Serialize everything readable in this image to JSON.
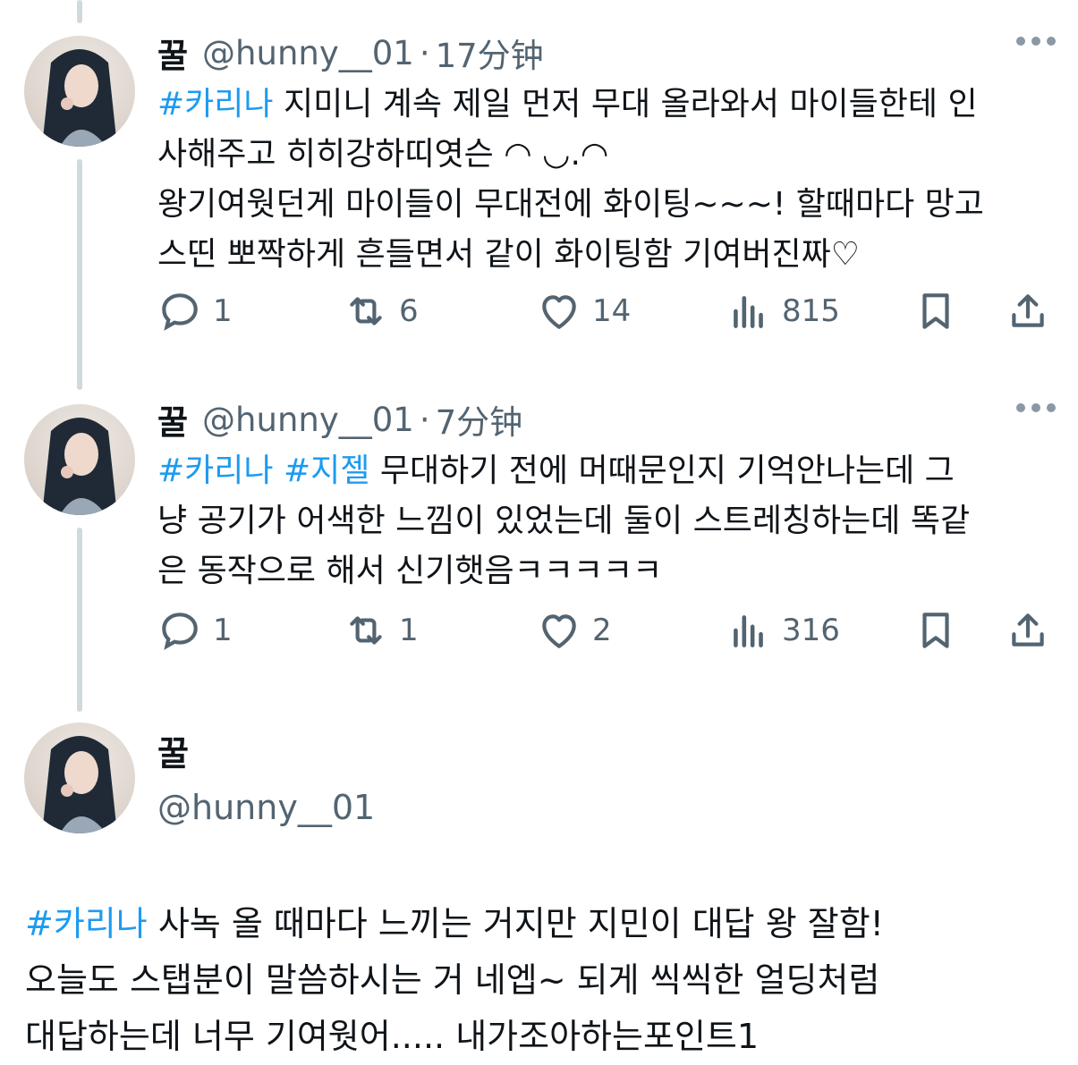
{
  "tweets": [
    {
      "display_name": "꿀",
      "handle": "@hunny__01",
      "dot": "·",
      "time": "17分钟",
      "hashtag_line1": "#카리나",
      "text_line1": " 지미니 계속 제일 먼저 무대 올라와서 마이들한테 인",
      "text_line2": "사해주고 히히강하띠엿슨 ◠ ◡.◠",
      "text_line3": "왕기여웟던게 마이들이 무대전에 화이팅~~~! 할때마다 망고",
      "text_line4": "스띤 뽀짝하게 흔들면서 같이 화이팅함 기여버진짜♡",
      "replies": "1",
      "retweets": "6",
      "likes": "14",
      "views": "815"
    },
    {
      "display_name": "꿀",
      "handle": "@hunny__01",
      "dot": "·",
      "time": "7分钟",
      "hashtag_a": "#카리나",
      "hashtag_b": "#지젤",
      "text_line1": " 무대하기 전에 머때문인지 기억안나는데 그",
      "text_line2": "냥 공기가 어색한 느낌이 있었는데 둘이 스트레칭하는데 똑같",
      "text_line3": "은 동작으로 해서 신기햇음ㅋㅋㅋㅋㅋ",
      "replies": "1",
      "retweets": "1",
      "likes": "2",
      "views": "316"
    }
  ],
  "main_tweet": {
    "display_name": "꿀",
    "handle": "@hunny__01",
    "hashtag": "#카리나",
    "text_line1": " 사녹 올 때마다 느끼는 거지만 지민이 대답 왕 잘함!",
    "text_line2": "오늘도 스탭분이 말씀하시는 거 네엡~ 되게 씩씩한 얼딩처럼",
    "text_line3": "대답하는데 너무 기여웟어..... 내가조아하는포인트1"
  },
  "icons": {
    "reply": "reply-icon",
    "retweet": "retweet-icon",
    "like": "heart-icon",
    "views": "views-icon",
    "bookmark": "bookmark-icon",
    "share": "share-icon",
    "more": "more-icon"
  },
  "colors": {
    "hashtag": "#1d9bf0",
    "muted": "#536471",
    "thread_line": "#cfd9de"
  }
}
